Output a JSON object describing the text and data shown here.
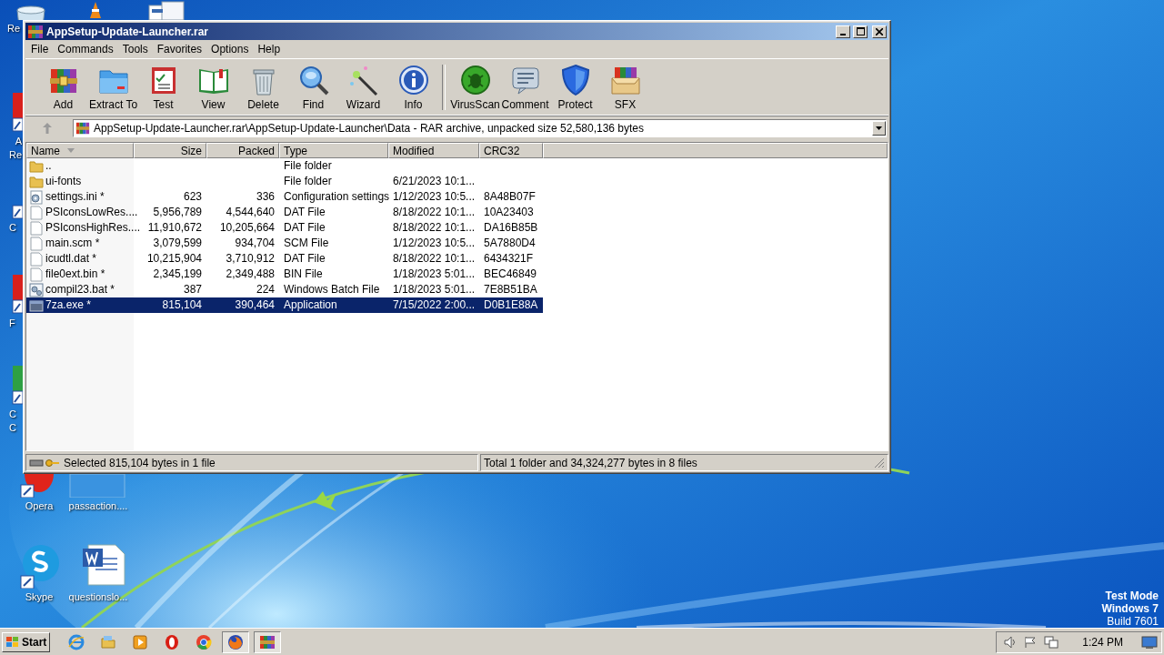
{
  "desktop_icons": [
    {
      "kind": "recycle",
      "label": "Re"
    },
    {
      "kind": "cone"
    },
    {
      "kind": "doc"
    },
    {
      "kind": "red",
      "label": "A Re"
    },
    {
      "kind": "shortcut",
      "label": "C"
    },
    {
      "kind": "red",
      "label": "F"
    },
    {
      "kind": "green",
      "label": "C C"
    },
    {
      "kind": "opera",
      "label": "Opera"
    },
    {
      "kind": "blank",
      "label": "passaction...."
    },
    {
      "kind": "skype",
      "label": "Skype"
    },
    {
      "kind": "word",
      "label": "questionslo..."
    }
  ],
  "window": {
    "title": "AppSetup-Update-Launcher.rar"
  },
  "menu": [
    "File",
    "Commands",
    "Tools",
    "Favorites",
    "Options",
    "Help"
  ],
  "toolbar": [
    {
      "label": "Add",
      "kind": "add"
    },
    {
      "label": "Extract To",
      "kind": "extract"
    },
    {
      "label": "Test",
      "kind": "test"
    },
    {
      "label": "View",
      "kind": "view"
    },
    {
      "label": "Delete",
      "kind": "delete"
    },
    {
      "label": "Find",
      "kind": "find"
    },
    {
      "label": "Wizard",
      "kind": "wizard"
    },
    {
      "label": "Info",
      "kind": "info"
    },
    {
      "label": "VirusScan",
      "kind": "virus"
    },
    {
      "label": "Comment",
      "kind": "comment"
    },
    {
      "label": "Protect",
      "kind": "protect"
    },
    {
      "label": "SFX",
      "kind": "sfx"
    }
  ],
  "address": {
    "path": "AppSetup-Update-Launcher.rar\\AppSetup-Update-Launcher\\Data - RAR archive, unpacked size 52,580,136 bytes"
  },
  "columns": [
    {
      "label": "Name",
      "sorted": true
    },
    {
      "label": "Size",
      "sorted": false
    },
    {
      "label": "Packed",
      "sorted": false
    },
    {
      "label": "Type",
      "sorted": false
    },
    {
      "label": "Modified",
      "sorted": false
    },
    {
      "label": "CRC32",
      "sorted": false
    }
  ],
  "rows": [
    {
      "kind": "folder",
      "name": "..",
      "type": "File folder",
      "selected": false
    },
    {
      "kind": "folder",
      "name": "ui-fonts",
      "type": "File folder",
      "modified": "6/21/2023 10:1...",
      "selected": false
    },
    {
      "kind": "config",
      "name": "settings.ini *",
      "size": "623",
      "packed": "336",
      "type": "Configuration settings",
      "modified": "1/12/2023 10:5...",
      "crc": "8A48B07F",
      "selected": false
    },
    {
      "kind": "file",
      "name": "PSIconsLowRes....",
      "size": "5,956,789",
      "packed": "4,544,640",
      "type": "DAT File",
      "modified": "8/18/2022 10:1...",
      "crc": "10A23403",
      "selected": false
    },
    {
      "kind": "file",
      "name": "PSIconsHighRes....",
      "size": "11,910,672",
      "packed": "10,205,664",
      "type": "DAT File",
      "modified": "8/18/2022 10:1...",
      "crc": "DA16B85B",
      "selected": false
    },
    {
      "kind": "file",
      "name": "main.scm *",
      "size": "3,079,599",
      "packed": "934,704",
      "type": "SCM File",
      "modified": "1/12/2023 10:5...",
      "crc": "5A7880D4",
      "selected": false
    },
    {
      "kind": "file",
      "name": "icudtl.dat *",
      "size": "10,215,904",
      "packed": "3,710,912",
      "type": "DAT File",
      "modified": "8/18/2022 10:1...",
      "crc": "6434321F",
      "selected": false
    },
    {
      "kind": "file",
      "name": "file0ext.bin *",
      "size": "2,345,199",
      "packed": "2,349,488",
      "type": "BIN File",
      "modified": "1/18/2023 5:01...",
      "crc": "BEC46849",
      "selected": false
    },
    {
      "kind": "batch",
      "name": "compil23.bat *",
      "size": "387",
      "packed": "224",
      "type": "Windows Batch File",
      "modified": "1/18/2023 5:01...",
      "crc": "7E8B51BA",
      "selected": false
    },
    {
      "kind": "exe",
      "name": "7za.exe *",
      "size": "815,104",
      "packed": "390,464",
      "type": "Application",
      "modified": "7/15/2022 2:00...",
      "crc": "D0B1E88A",
      "selected": true
    }
  ],
  "status": {
    "selected": "Selected 815,104 bytes in 1 file",
    "total": "Total 1 folder and 34,324,277 bytes in 8 files"
  },
  "os_notice": [
    "Test Mode",
    "Windows 7",
    "Build 7601"
  ],
  "taskbar": {
    "start": "Start",
    "apps": [
      {
        "kind": "ie",
        "active": false
      },
      {
        "kind": "explorer",
        "active": false
      },
      {
        "kind": "media",
        "active": false
      },
      {
        "kind": "opera",
        "active": false
      },
      {
        "kind": "chrome",
        "active": false
      },
      {
        "kind": "firefox",
        "active": true
      },
      {
        "kind": "winrar",
        "active": true
      }
    ],
    "clock": "1:24 PM"
  }
}
